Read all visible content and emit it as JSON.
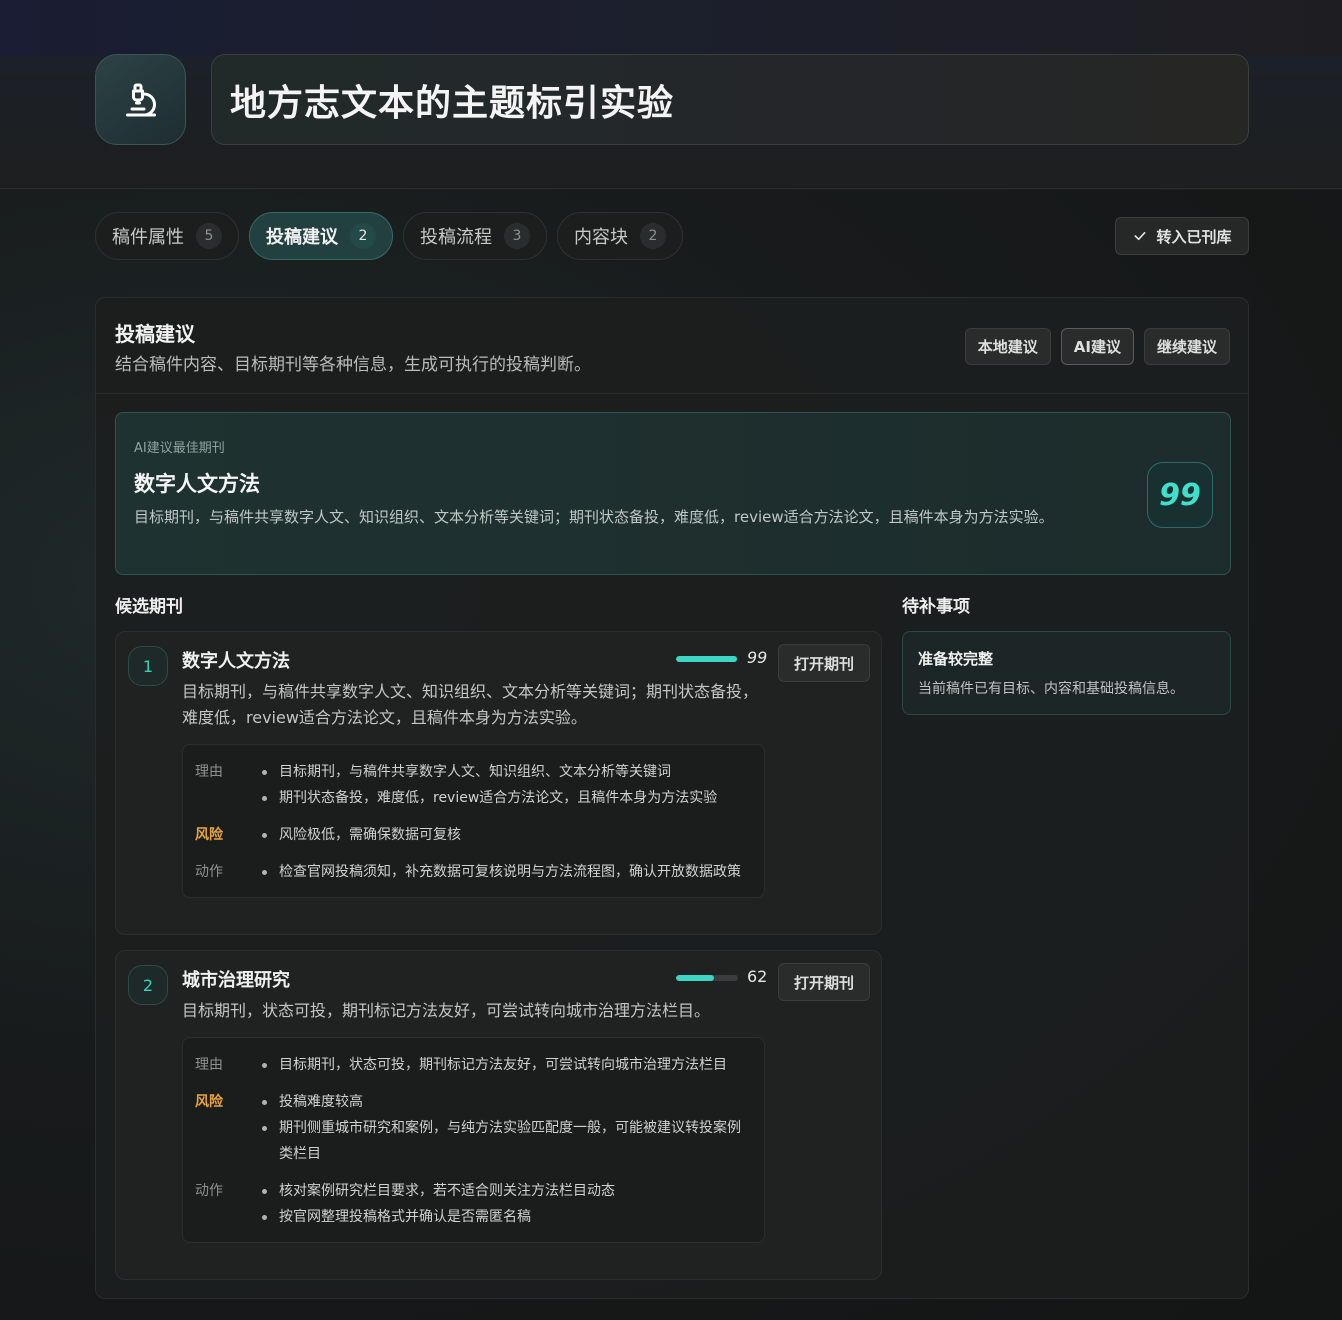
{
  "header": {
    "title": "地方志文本的主题标引实验",
    "icon": "microscope-icon"
  },
  "tabs": [
    {
      "label": "稿件属性",
      "count": "5",
      "active": false
    },
    {
      "label": "投稿建议",
      "count": "2",
      "active": true
    },
    {
      "label": "投稿流程",
      "count": "3",
      "active": false
    },
    {
      "label": "内容块",
      "count": "2",
      "active": false
    }
  ],
  "archive_button": {
    "label": "转入已刊库",
    "icon": "check-icon"
  },
  "panel": {
    "title": "投稿建议",
    "subtitle": "结合稿件内容、目标期刊等各种信息，生成可执行的投稿判断。",
    "buttons": {
      "local": "本地建议",
      "ai": "AI建议",
      "continue": "继续建议"
    }
  },
  "best": {
    "label": "AI建议最佳期刊",
    "name": "数字人文方法",
    "desc": "目标期刊，与稿件共享数字人文、知识组织、文本分析等关键词；期刊状态备投，难度低，review适合方法论文，且稿件本身为方法实验。",
    "score": "99"
  },
  "sections": {
    "candidates": "候选期刊",
    "todo": "待补事项"
  },
  "labels": {
    "reason": "理由",
    "risk": "风险",
    "action": "动作",
    "open": "打开期刊"
  },
  "candidates": [
    {
      "index": "1",
      "name": "数字人文方法",
      "score": "99",
      "score_value": 99,
      "desc": "目标期刊，与稿件共享数字人文、知识组织、文本分析等关键词；期刊状态备投，难度低，review适合方法论文，且稿件本身为方法实验。",
      "reasons": [
        "目标期刊，与稿件共享数字人文、知识组织、文本分析等关键词",
        "期刊状态备投，难度低，review适合方法论文，且稿件本身为方法实验"
      ],
      "risks": [
        "风险极低，需确保数据可复核"
      ],
      "actions": [
        "检查官网投稿须知，补充数据可复核说明与方法流程图，确认开放数据政策"
      ]
    },
    {
      "index": "2",
      "name": "城市治理研究",
      "score": "62",
      "score_value": 62,
      "desc": "目标期刊，状态可投，期刊标记方法友好，可尝试转向城市治理方法栏目。",
      "reasons": [
        "目标期刊，状态可投，期刊标记方法友好，可尝试转向城市治理方法栏目"
      ],
      "risks": [
        "投稿难度较高",
        "期刊侧重城市研究和案例，与纯方法实验匹配度一般，可能被建议转投案例类栏目"
      ],
      "actions": [
        "核对案例研究栏目要求，若不适合则关注方法栏目动态",
        "按官网整理投稿格式并确认是否需匿名稿"
      ]
    }
  ],
  "todo": {
    "title": "准备较完整",
    "desc": "当前稿件已有目标、内容和基础投稿信息。"
  },
  "colors": {
    "accent": "#3dd6c4",
    "risk": "#e7a43b"
  }
}
